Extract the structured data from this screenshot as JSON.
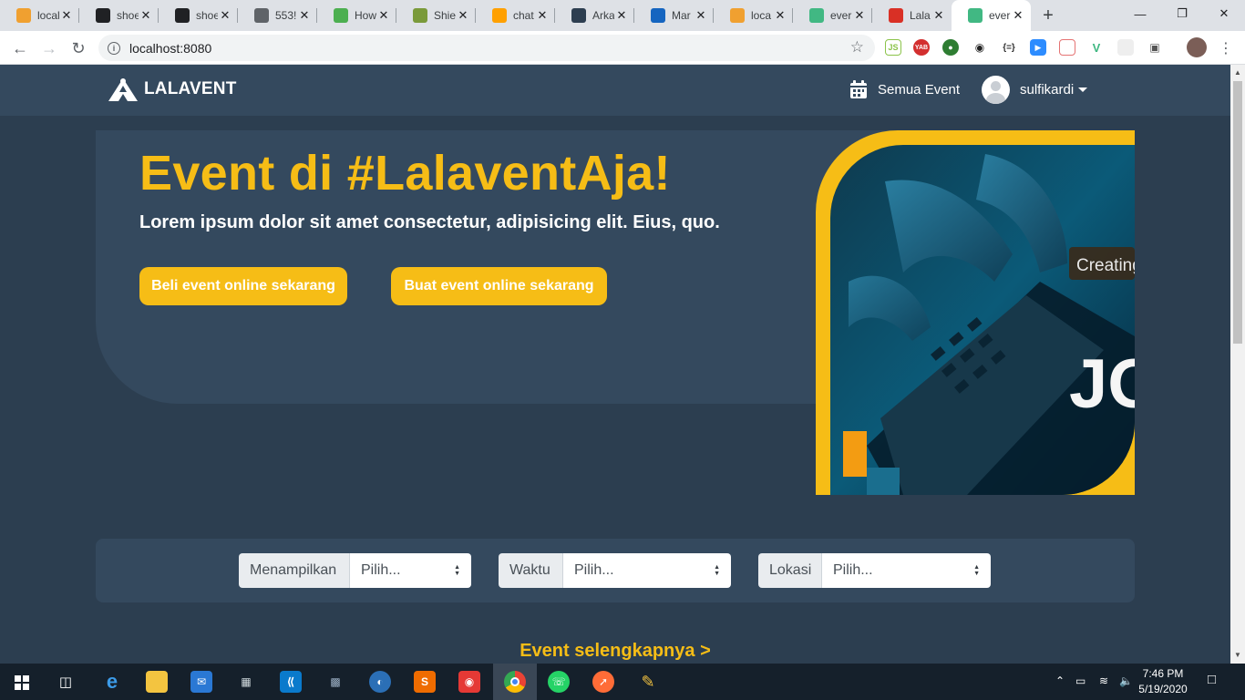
{
  "browser": {
    "tabs": [
      {
        "title": "local",
        "icon": "phpmyadmin-icon",
        "color": "#f0a030"
      },
      {
        "title": "shoe",
        "icon": "github-icon",
        "color": "#202124"
      },
      {
        "title": "shoe",
        "icon": "github-icon",
        "color": "#202124"
      },
      {
        "title": "553!",
        "icon": "globe-icon",
        "color": "#5f6368"
      },
      {
        "title": "How",
        "icon": "w3schools-icon",
        "color": "#4caf50"
      },
      {
        "title": "Shie",
        "icon": "shields-icon",
        "color": "#7a9a3a"
      },
      {
        "title": "chat",
        "icon": "firebase-icon",
        "color": "#ffa000"
      },
      {
        "title": "Arka",
        "icon": "arkademy-icon",
        "color": "#2d3e50"
      },
      {
        "title": "Mar",
        "icon": "cube-icon",
        "color": "#1565c0"
      },
      {
        "title": "loca",
        "icon": "phpmyadmin-icon",
        "color": "#f0a030"
      },
      {
        "title": "ever",
        "icon": "vue-icon",
        "color": "#41b883"
      },
      {
        "title": "Lala",
        "icon": "gmail-icon",
        "color": "#d93025"
      },
      {
        "title": "ever",
        "icon": "vue-icon",
        "color": "#41b883"
      }
    ],
    "active_tab": 12,
    "url": "localhost:8080"
  },
  "site": {
    "brand": "LALAVENT",
    "nav_events": "Semua Event",
    "username": "sulfikardi"
  },
  "hero": {
    "title": "Event di #LalaventAja!",
    "subtitle": "Lorem ipsum dolor sit amet consectetur, adipisicing elit. Eius, quo.",
    "btn_buy": "Beli event online sekarang",
    "btn_create": "Buat event online sekarang",
    "image_caption": "Creating a",
    "image_text": "JO"
  },
  "filters": [
    {
      "label": "Menampilkan",
      "value": "Pilih..."
    },
    {
      "label": "Waktu",
      "value": "Pilih..."
    },
    {
      "label": "Lokasi",
      "value": "Pilih..."
    }
  ],
  "more_link": "Event selengkapnya >",
  "taskbar": {
    "time": "7:46 PM",
    "date": "5/19/2020"
  },
  "colors": {
    "accent": "#f6bd16",
    "navbar": "#34495e",
    "background": "#2c3e50"
  }
}
